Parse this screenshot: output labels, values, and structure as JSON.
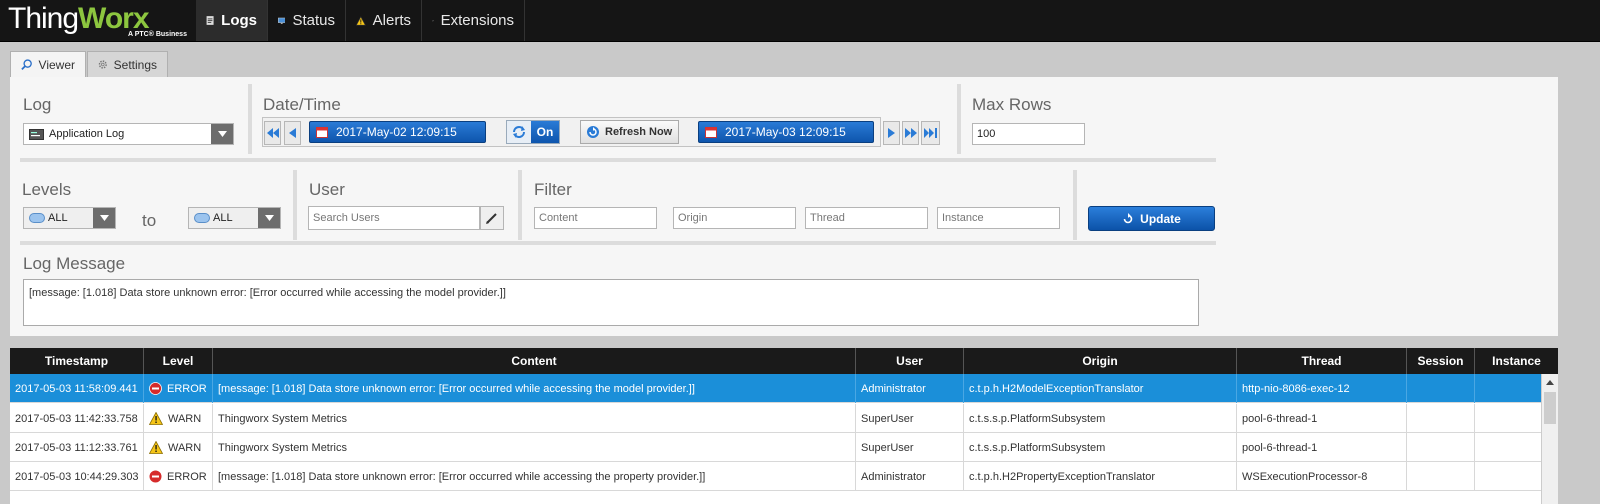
{
  "app": {
    "logo_main": "Thing",
    "logo_accent": "Worx",
    "logo_sub": "A PTC® Business"
  },
  "nav": [
    {
      "label": "Logs",
      "icon": "logs-icon",
      "active": true
    },
    {
      "label": "Status",
      "icon": "monitor-icon"
    },
    {
      "label": "Alerts",
      "icon": "warning-icon"
    },
    {
      "label": "Extensions",
      "icon": "plug-icon"
    }
  ],
  "subtabs": [
    {
      "label": "Viewer",
      "icon": "magnifier-icon",
      "active": true
    },
    {
      "label": "Settings",
      "icon": "gear-icon"
    }
  ],
  "log": {
    "label": "Log",
    "selected": "Application Log"
  },
  "datetime": {
    "label": "Date/Time",
    "start": "2017-May-02 12:09:15",
    "end": "2017-May-03 12:09:15",
    "auto_refresh": "On",
    "refresh_label": "Refresh Now"
  },
  "max_rows": {
    "label": "Max Rows",
    "value": "100"
  },
  "levels": {
    "label": "Levels",
    "from": "ALL",
    "to_word": "to",
    "to": "ALL"
  },
  "user": {
    "label": "User",
    "placeholder": "Search Users"
  },
  "filter": {
    "label": "Filter",
    "content_placeholder": "Content",
    "origin_placeholder": "Origin",
    "thread_placeholder": "Thread",
    "instance_placeholder": "Instance"
  },
  "update_label": "Update",
  "log_message": {
    "label": "Log Message",
    "text": "[message: [1.018] Data store unknown error: [Error occurred while accessing the model provider.]]"
  },
  "table": {
    "columns": [
      "Timestamp",
      "Level",
      "Content",
      "User",
      "Origin",
      "Thread",
      "Session",
      "Instance"
    ],
    "rows": [
      {
        "timestamp": "2017-05-03 11:58:09.441",
        "level": "ERROR",
        "content": "[message: [1.018] Data store unknown error: [Error occurred while accessing the model provider.]]",
        "user": "Administrator",
        "origin": "c.t.p.h.H2ModelExceptionTranslator",
        "thread": "http-nio-8086-exec-12",
        "session": "",
        "instance": ""
      },
      {
        "timestamp": "2017-05-03 11:42:33.758",
        "level": "WARN",
        "content": "Thingworx System Metrics",
        "user": "SuperUser",
        "origin": "c.t.s.s.p.PlatformSubsystem",
        "thread": "pool-6-thread-1",
        "session": "",
        "instance": ""
      },
      {
        "timestamp": "2017-05-03 11:12:33.761",
        "level": "WARN",
        "content": "Thingworx System Metrics",
        "user": "SuperUser",
        "origin": "c.t.s.s.p.PlatformSubsystem",
        "thread": "pool-6-thread-1",
        "session": "",
        "instance": ""
      },
      {
        "timestamp": "2017-05-03 10:44:29.303",
        "level": "ERROR",
        "content": "[message: [1.018] Data store unknown error: [Error occurred while accessing the property provider.]]",
        "user": "Administrator",
        "origin": "c.t.p.h.H2PropertyExceptionTranslator",
        "thread": "WSExecutionProcessor-8",
        "session": "",
        "instance": ""
      }
    ]
  }
}
